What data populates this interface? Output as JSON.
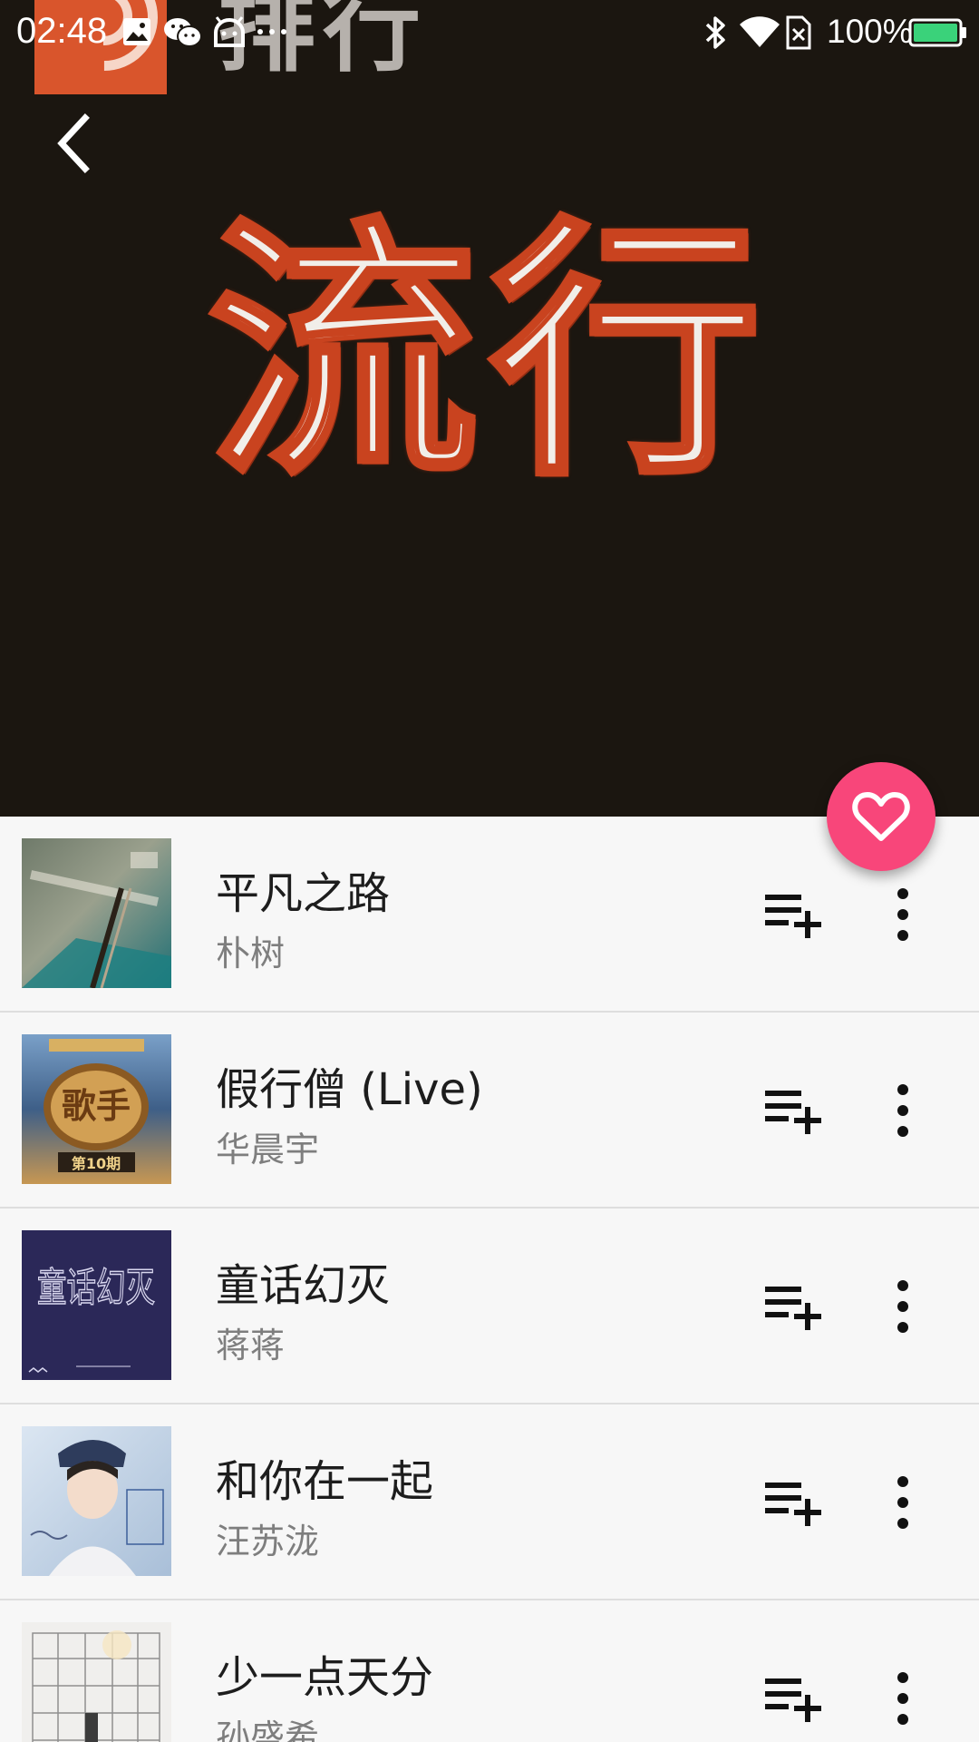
{
  "status_bar": {
    "time": "02:48",
    "battery_text": "100%",
    "left_icons": [
      "gallery-icon",
      "wechat-icon",
      "android-icon",
      "more-dots-icon"
    ],
    "right_icons": [
      "bluetooth-icon",
      "wifi-icon",
      "no-sim-icon",
      "battery-icon"
    ]
  },
  "header": {
    "logo_text": "排行",
    "cover_title": "流行"
  },
  "fab": {
    "icon": "heart-outline-icon",
    "color": "#f8467a"
  },
  "songs": [
    {
      "title": "平凡之路",
      "artist": "朴树"
    },
    {
      "title": "假行僧 (Live)",
      "artist": "华晨宇"
    },
    {
      "title": "童话幻灭",
      "artist": "蒋蒋"
    },
    {
      "title": "和你在一起",
      "artist": "汪苏泷"
    },
    {
      "title": "少一点天分",
      "artist": "孙盛希"
    }
  ],
  "covers": {
    "cover_2_text_1": "歌手",
    "cover_2_text_2": "第10期",
    "cover_3_text": "童话幻灭"
  },
  "row_icons": {
    "add": "playlist-add-icon",
    "more": "more-vertical-icon"
  }
}
